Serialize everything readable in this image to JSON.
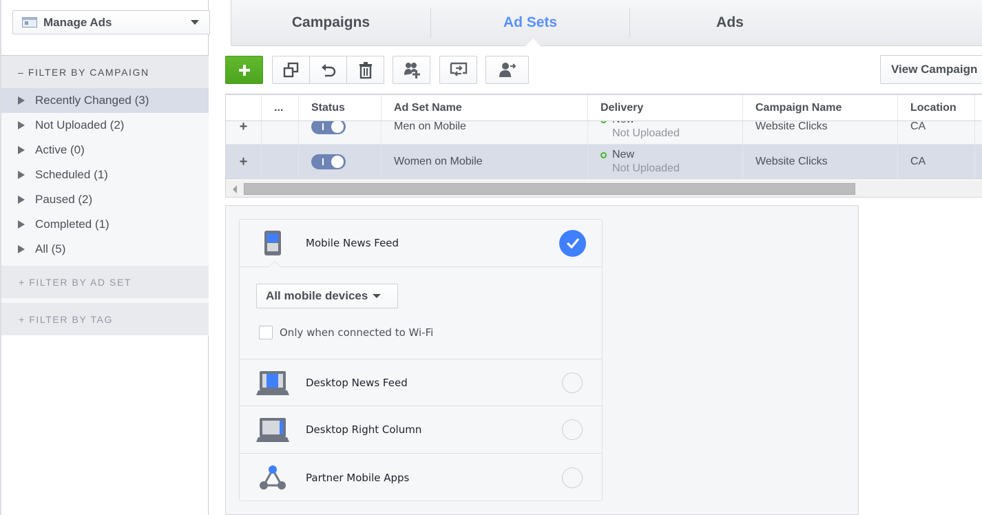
{
  "sidebar": {
    "manage_ads_label": "Manage Ads",
    "filter_by_campaign": "– FILTER BY CAMPAIGN",
    "filters": [
      {
        "label": "Recently Changed (3)",
        "active": true
      },
      {
        "label": "Not Uploaded (2)",
        "active": false
      },
      {
        "label": "Active (0)",
        "active": false
      },
      {
        "label": "Scheduled (1)",
        "active": false
      },
      {
        "label": "Paused (2)",
        "active": false
      },
      {
        "label": "Completed (1)",
        "active": false
      },
      {
        "label": "All (5)",
        "active": false
      }
    ],
    "filter_by_ad_set": "+ FILTER BY AD SET",
    "filter_by_tag": "+ FILTER BY TAG"
  },
  "tabs": [
    {
      "label": "Campaigns",
      "selected": false
    },
    {
      "label": "Ad Sets",
      "selected": true
    },
    {
      "label": "Ads",
      "selected": false
    }
  ],
  "toolbar": {
    "buttons": [
      "create-icon",
      "duplicate-icon",
      "revert-icon",
      "delete-icon",
      "add-audience-icon",
      "export-import-icon",
      "share-user-icon"
    ],
    "view_campaign_label": "View Campaign"
  },
  "table": {
    "columns": [
      "",
      "...",
      "Status",
      "Ad Set Name",
      "Delivery",
      "Campaign Name",
      "Location"
    ],
    "rows": [
      {
        "expand": "+",
        "status_on": true,
        "name": "Men on Mobile",
        "delivery": "New",
        "delivery_sub": "Not Uploaded",
        "campaign": "Website Clicks",
        "location": "CA",
        "selected": false
      },
      {
        "expand": "+",
        "status_on": true,
        "name": "Women on Mobile",
        "delivery": "New",
        "delivery_sub": "Not Uploaded",
        "campaign": "Website Clicks",
        "location": "CA",
        "selected": true
      }
    ]
  },
  "placements": {
    "mobile_news_feed": {
      "label": "Mobile News Feed",
      "selected": true
    },
    "device_select": "All mobile devices",
    "wifi_only": {
      "label": "Only when connected to Wi-Fi",
      "checked": false
    },
    "desktop_news_feed": {
      "label": "Desktop News Feed",
      "selected": false
    },
    "desktop_right_column": {
      "label": "Desktop Right Column",
      "selected": false
    },
    "partner_mobile_apps": {
      "label": "Partner Mobile Apps",
      "selected": false
    }
  },
  "colors": {
    "accent": "#5890ff",
    "check": "#4080ff",
    "create_green": "#4ca51f",
    "selected_row": "#d8dde8",
    "delivery_new": "#42b72a"
  }
}
